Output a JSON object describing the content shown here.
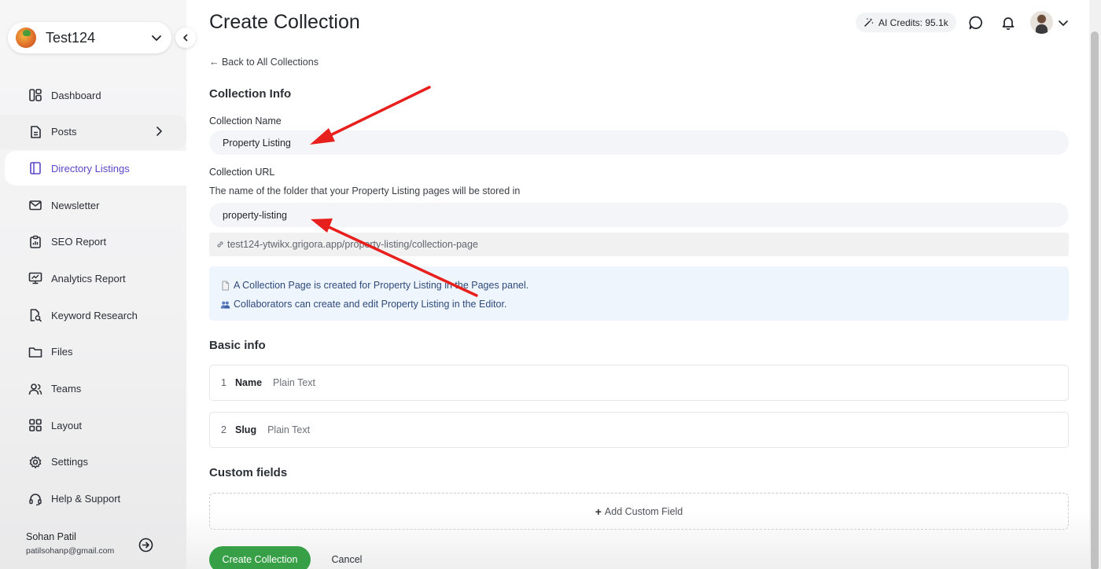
{
  "workspace": {
    "name": "Test124"
  },
  "sidebar": {
    "items": [
      {
        "label": "Dashboard",
        "icon": "dashboard-icon"
      },
      {
        "label": "Posts",
        "icon": "document-icon"
      },
      {
        "label": "Directory Listings",
        "icon": "book-icon"
      },
      {
        "label": "Newsletter",
        "icon": "mail-icon"
      },
      {
        "label": "SEO Report",
        "icon": "clipboard-icon"
      },
      {
        "label": "Analytics Report",
        "icon": "monitor-chart-icon"
      },
      {
        "label": "Keyword Research",
        "icon": "file-search-icon"
      },
      {
        "label": "Files",
        "icon": "folder-icon"
      },
      {
        "label": "Teams",
        "icon": "users-icon"
      },
      {
        "label": "Layout",
        "icon": "grid-icon"
      },
      {
        "label": "Settings",
        "icon": "gear-icon"
      },
      {
        "label": "Help & Support",
        "icon": "headset-icon"
      }
    ],
    "active": "Directory Listings"
  },
  "user": {
    "name": "Sohan Patil",
    "email": "patilsohanp@gmail.com"
  },
  "header": {
    "title": "Create Collection",
    "credits": "AI Credits: 95.1k"
  },
  "back_link": "← Back to All Collections",
  "collection_info": {
    "title": "Collection Info",
    "name_label": "Collection Name",
    "name_value": "Property Listing",
    "url_label": "Collection URL",
    "url_help": "The name of the folder that your Property Listing pages will be stored in",
    "url_value": "property-listing",
    "url_preview": "test124-ytwikx.grigora.app/property-listing/collection-page",
    "info_lines": [
      "A Collection Page is created for Property Listing in the Pages panel.",
      "Collaborators can create and edit Property Listing in the Editor."
    ]
  },
  "basic_info": {
    "title": "Basic info",
    "fields": [
      {
        "num": "1",
        "name": "Name",
        "type": "Plain Text"
      },
      {
        "num": "2",
        "name": "Slug",
        "type": "Plain Text"
      }
    ]
  },
  "custom_fields": {
    "title": "Custom fields",
    "add_label": "Add Custom Field"
  },
  "actions": {
    "create": "Create Collection",
    "cancel": "Cancel"
  },
  "colors": {
    "accent": "#5b46c7",
    "primary_button": "#37a046",
    "annotation": "#e8201d",
    "info_bg": "#eef5fd"
  }
}
